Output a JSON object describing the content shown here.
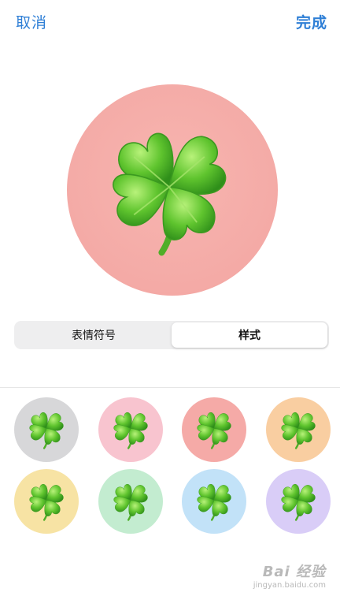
{
  "nav": {
    "cancel": "取消",
    "done": "完成"
  },
  "hero": {
    "icon": "four-leaf-clover-icon",
    "background": "#f4aaa6"
  },
  "segments": [
    {
      "label": "表情符号",
      "selected": false
    },
    {
      "label": "样式",
      "selected": true
    }
  ],
  "styles": [
    {
      "name": "gray",
      "color": "#d7d7d9"
    },
    {
      "name": "pink",
      "color": "#f8c4cf"
    },
    {
      "name": "salmon",
      "color": "#f5aaa7"
    },
    {
      "name": "orange",
      "color": "#f9cea1"
    },
    {
      "name": "yellow",
      "color": "#f7e3a4"
    },
    {
      "name": "green",
      "color": "#c3ecd0"
    },
    {
      "name": "blue",
      "color": "#c2e2f8"
    },
    {
      "name": "purple",
      "color": "#d9cdf7"
    }
  ],
  "watermark": {
    "logo": "Bai 经验",
    "sub": "jingyan.baidu.com"
  }
}
